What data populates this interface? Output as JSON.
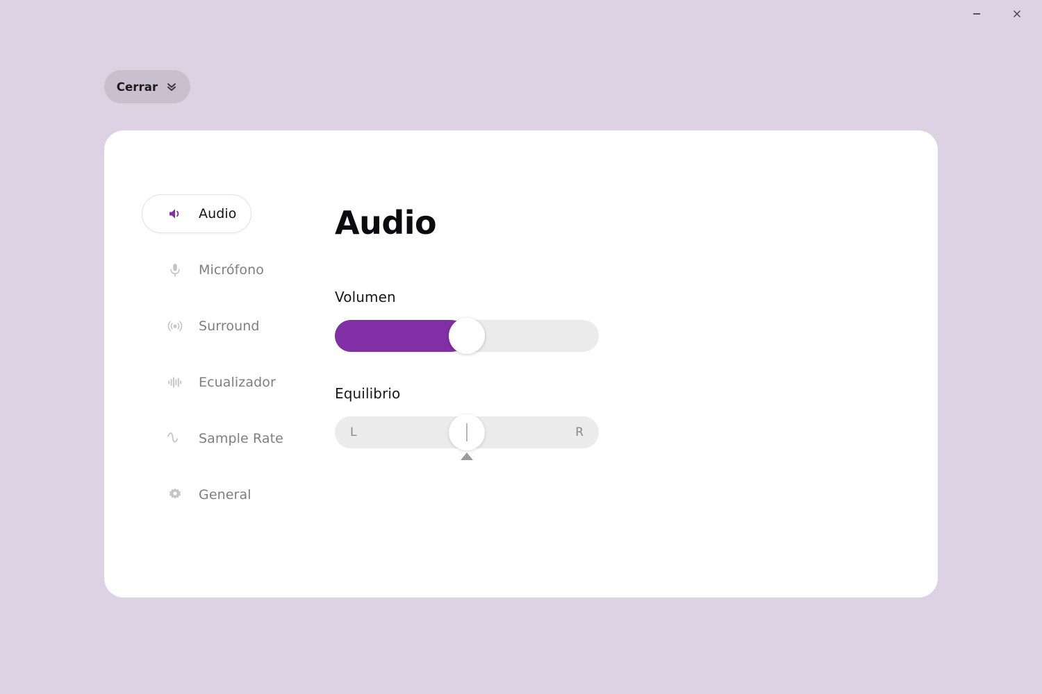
{
  "window": {
    "minimize_icon": "minimize-icon",
    "close_icon": "close-icon"
  },
  "topbar": {
    "close_button_label": "Cerrar",
    "close_button_icon": "double-chevron-down-icon"
  },
  "sidebar": {
    "items": [
      {
        "label": "Audio",
        "icon": "speaker-icon",
        "active": true
      },
      {
        "label": "Micrófono",
        "icon": "microphone-icon",
        "active": false
      },
      {
        "label": "Surround",
        "icon": "broadcast-icon",
        "active": false
      },
      {
        "label": "Ecualizador",
        "icon": "equalizer-icon",
        "active": false
      },
      {
        "label": "Sample Rate",
        "icon": "sine-wave-icon",
        "active": false
      },
      {
        "label": "General",
        "icon": "gear-icon",
        "active": false
      }
    ]
  },
  "main": {
    "title": "Audio",
    "volume": {
      "label": "Volumen",
      "value_percent": 50
    },
    "balance": {
      "label": "Equilibrio",
      "left_label": "L",
      "right_label": "R",
      "value_percent": 50
    }
  },
  "colors": {
    "background": "#dcd2e3",
    "card": "#ffffff",
    "accent": "#8030a4",
    "track": "#ebebeb",
    "muted_text": "#7f7d82",
    "pill": "#c9c0ce"
  }
}
